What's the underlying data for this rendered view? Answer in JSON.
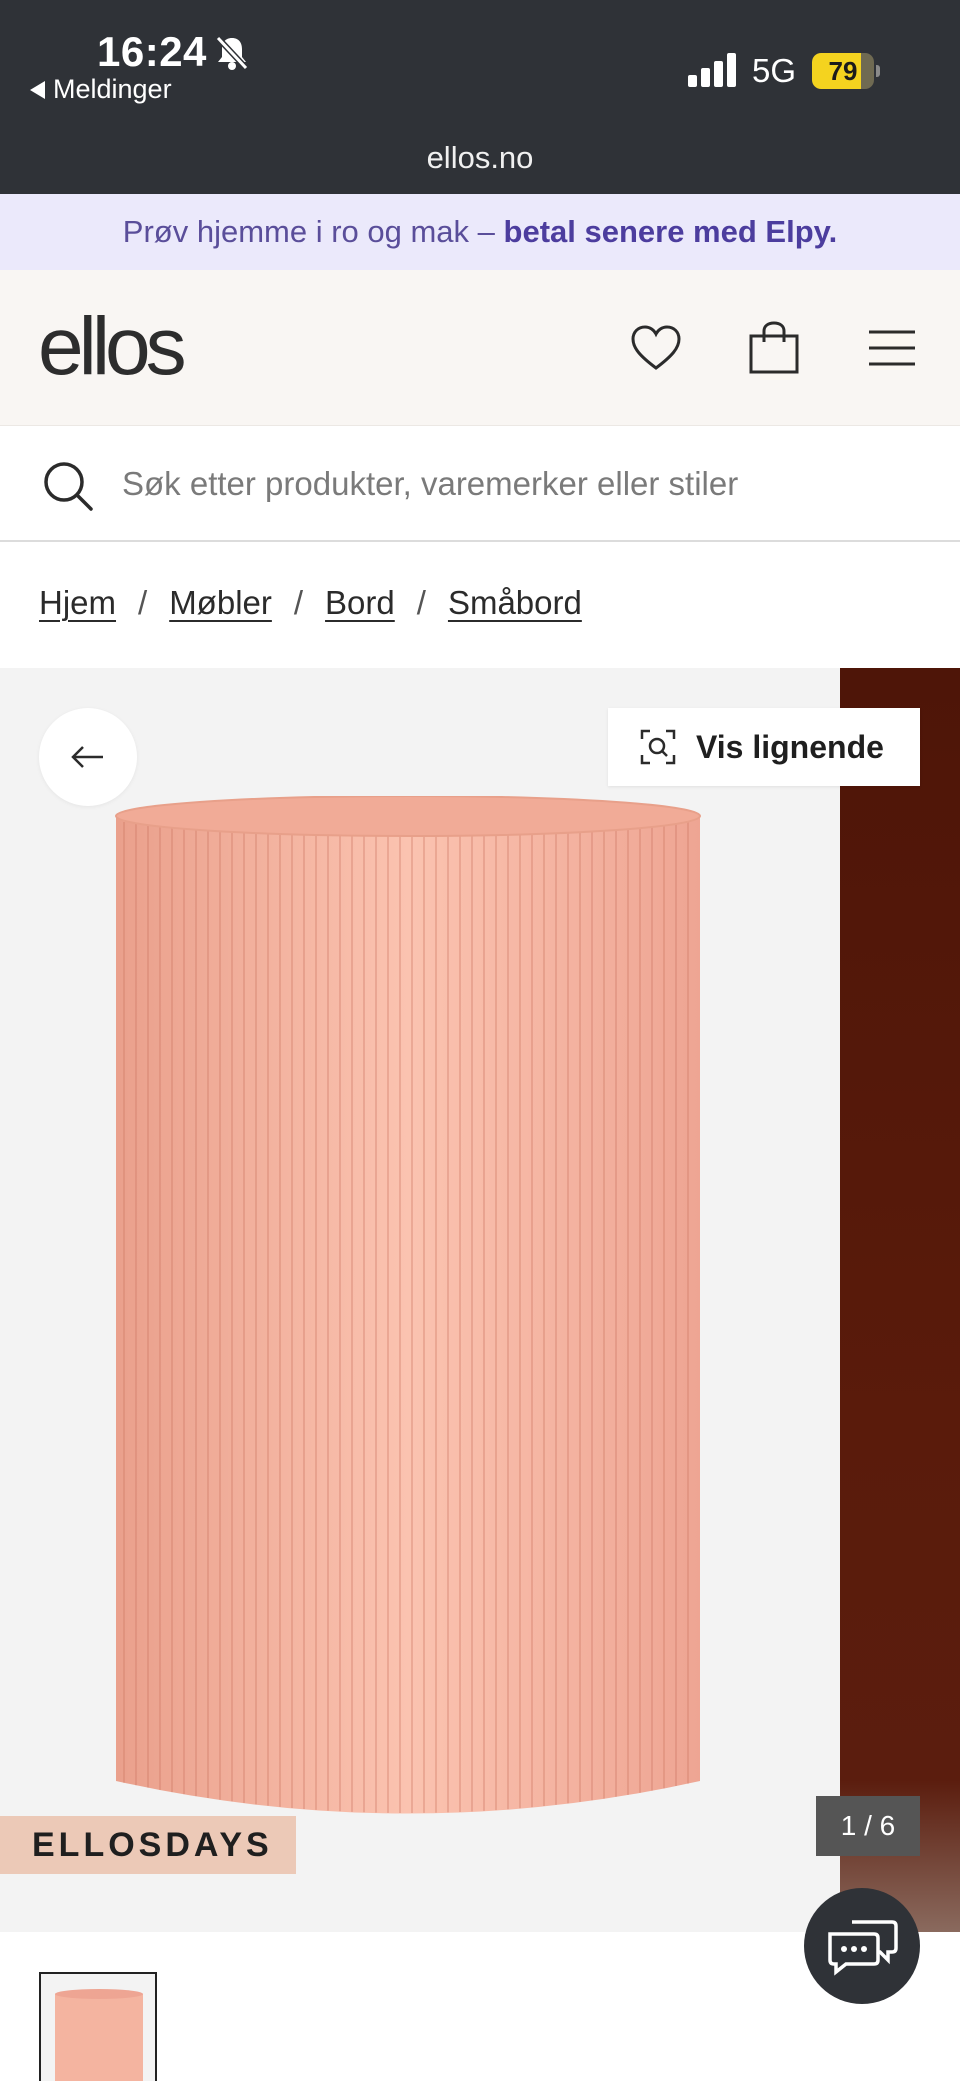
{
  "status_bar": {
    "time": "16:24",
    "back_label": "Meldinger",
    "network": "5G",
    "battery": "79",
    "battery_level": 0.79,
    "url": "ellos.no"
  },
  "promo": {
    "text": "Prøv hjemme i ro og mak – ",
    "bold_text": "betal senere med Elpy."
  },
  "header": {
    "logo": "ellos"
  },
  "search": {
    "placeholder": "Søk etter produkter, varemerker eller stiler"
  },
  "breadcrumb": {
    "items": [
      "Hjem",
      "Møbler",
      "Bord",
      "Småbord"
    ],
    "separator": "/"
  },
  "gallery": {
    "similar_label": "Vis lignende",
    "badge": "ELLOSDAYS",
    "counter": "1 / 6"
  },
  "colors": {
    "status_bar_bg": "#2f3237",
    "promo_bg": "#ebe9fb",
    "promo_text": "#5a4e9a",
    "header_bg": "#f9f6f3",
    "product_pink": "#f4b4a0",
    "badge_bg": "#ecc9b7",
    "next_image": "#4e1508"
  },
  "icons": {
    "bell_muted": "bell-slash-icon",
    "wishlist": "heart-icon",
    "cart": "shopping-bag-icon",
    "menu": "hamburger-menu-icon",
    "search": "search-icon",
    "back": "arrow-left-icon",
    "visual_search": "visual-search-icon",
    "chat": "chat-icon"
  }
}
